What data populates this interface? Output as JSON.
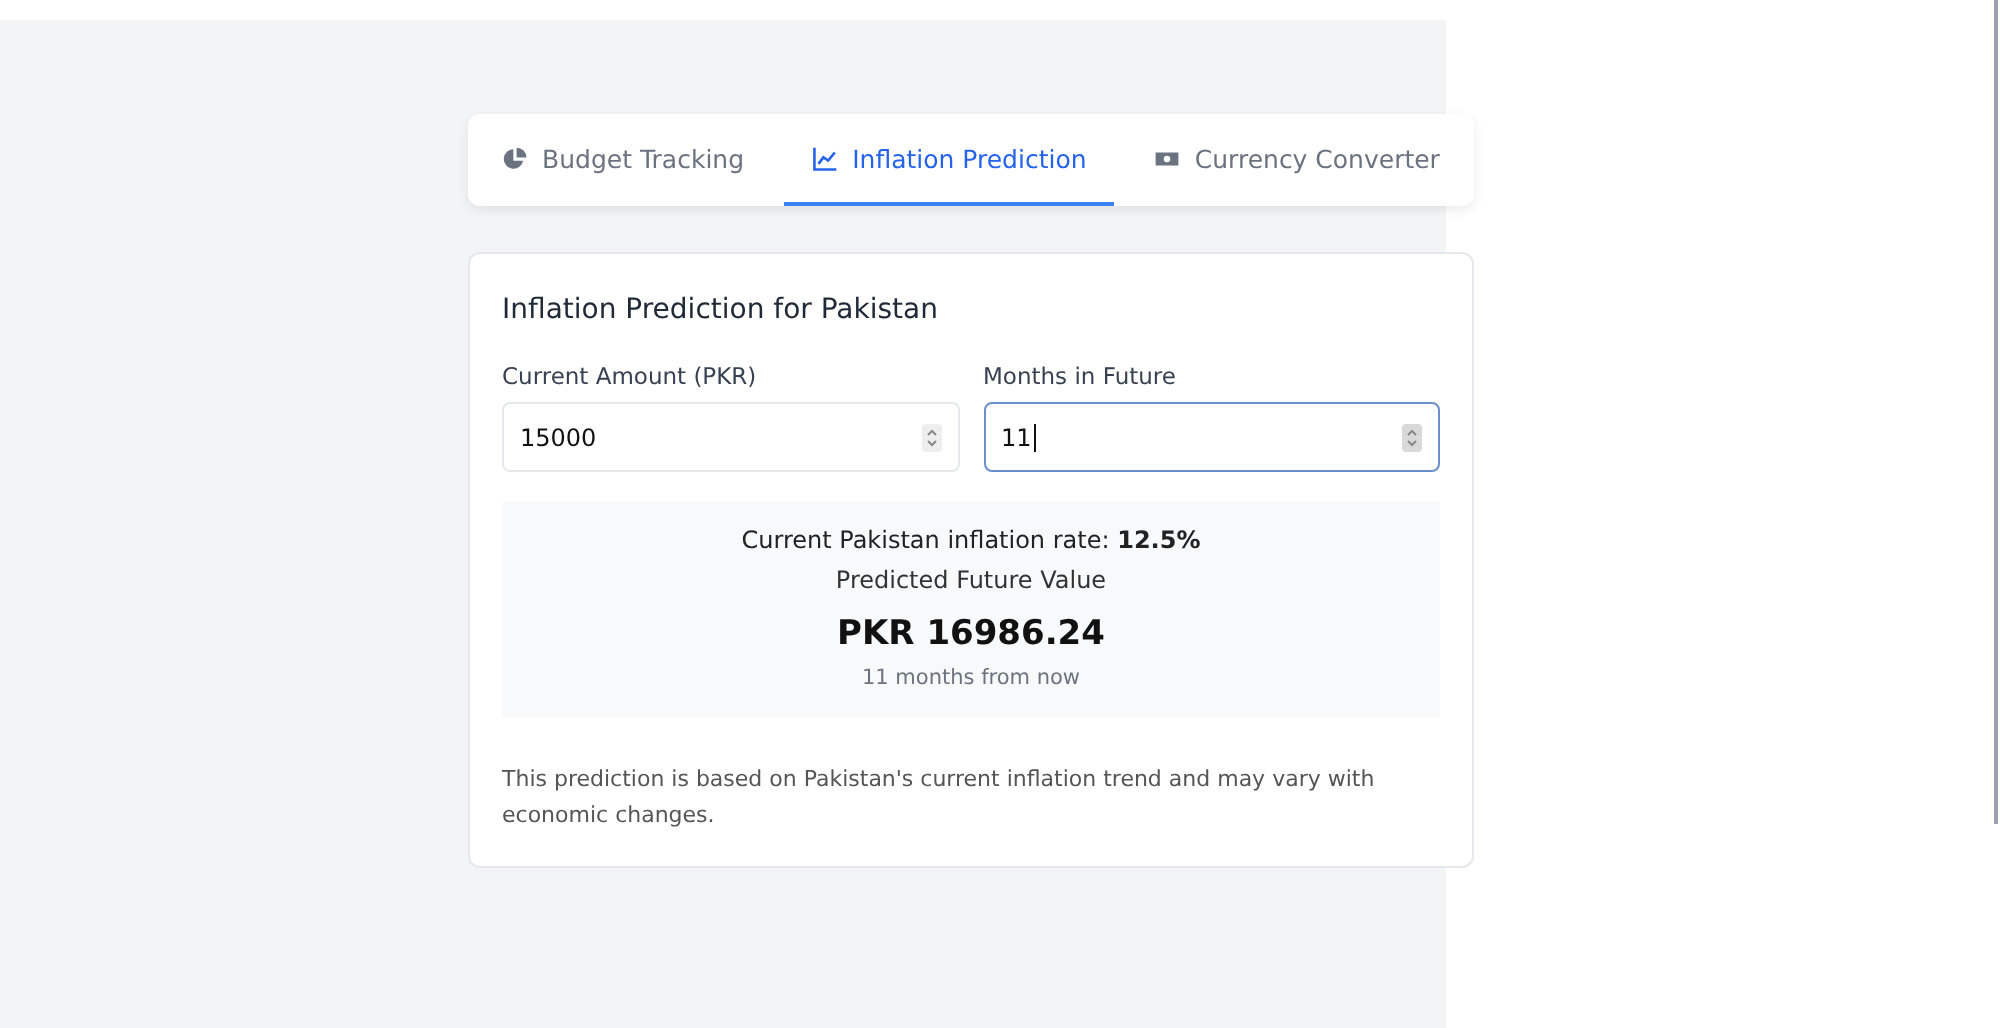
{
  "tabs": [
    {
      "label": "Budget Tracking",
      "selected": false
    },
    {
      "label": "Inflation Prediction",
      "selected": true
    },
    {
      "label": "Currency Converter",
      "selected": false
    }
  ],
  "card": {
    "title": "Inflation Prediction for Pakistan",
    "fields": [
      {
        "label": "Current Amount (PKR)",
        "value": "15000",
        "focused": false
      },
      {
        "label": "Months in Future",
        "value": "11",
        "focused": true
      }
    ],
    "result": {
      "rate_line": "Current Pakistan inflation rate: **12.5%**",
      "heading": "Predicted Future Value",
      "amount": "PKR 16986.24",
      "period": "11 months from now"
    },
    "note": "This prediction is based on Pakistan's current inflation trend and may vary with economic changes."
  }
}
